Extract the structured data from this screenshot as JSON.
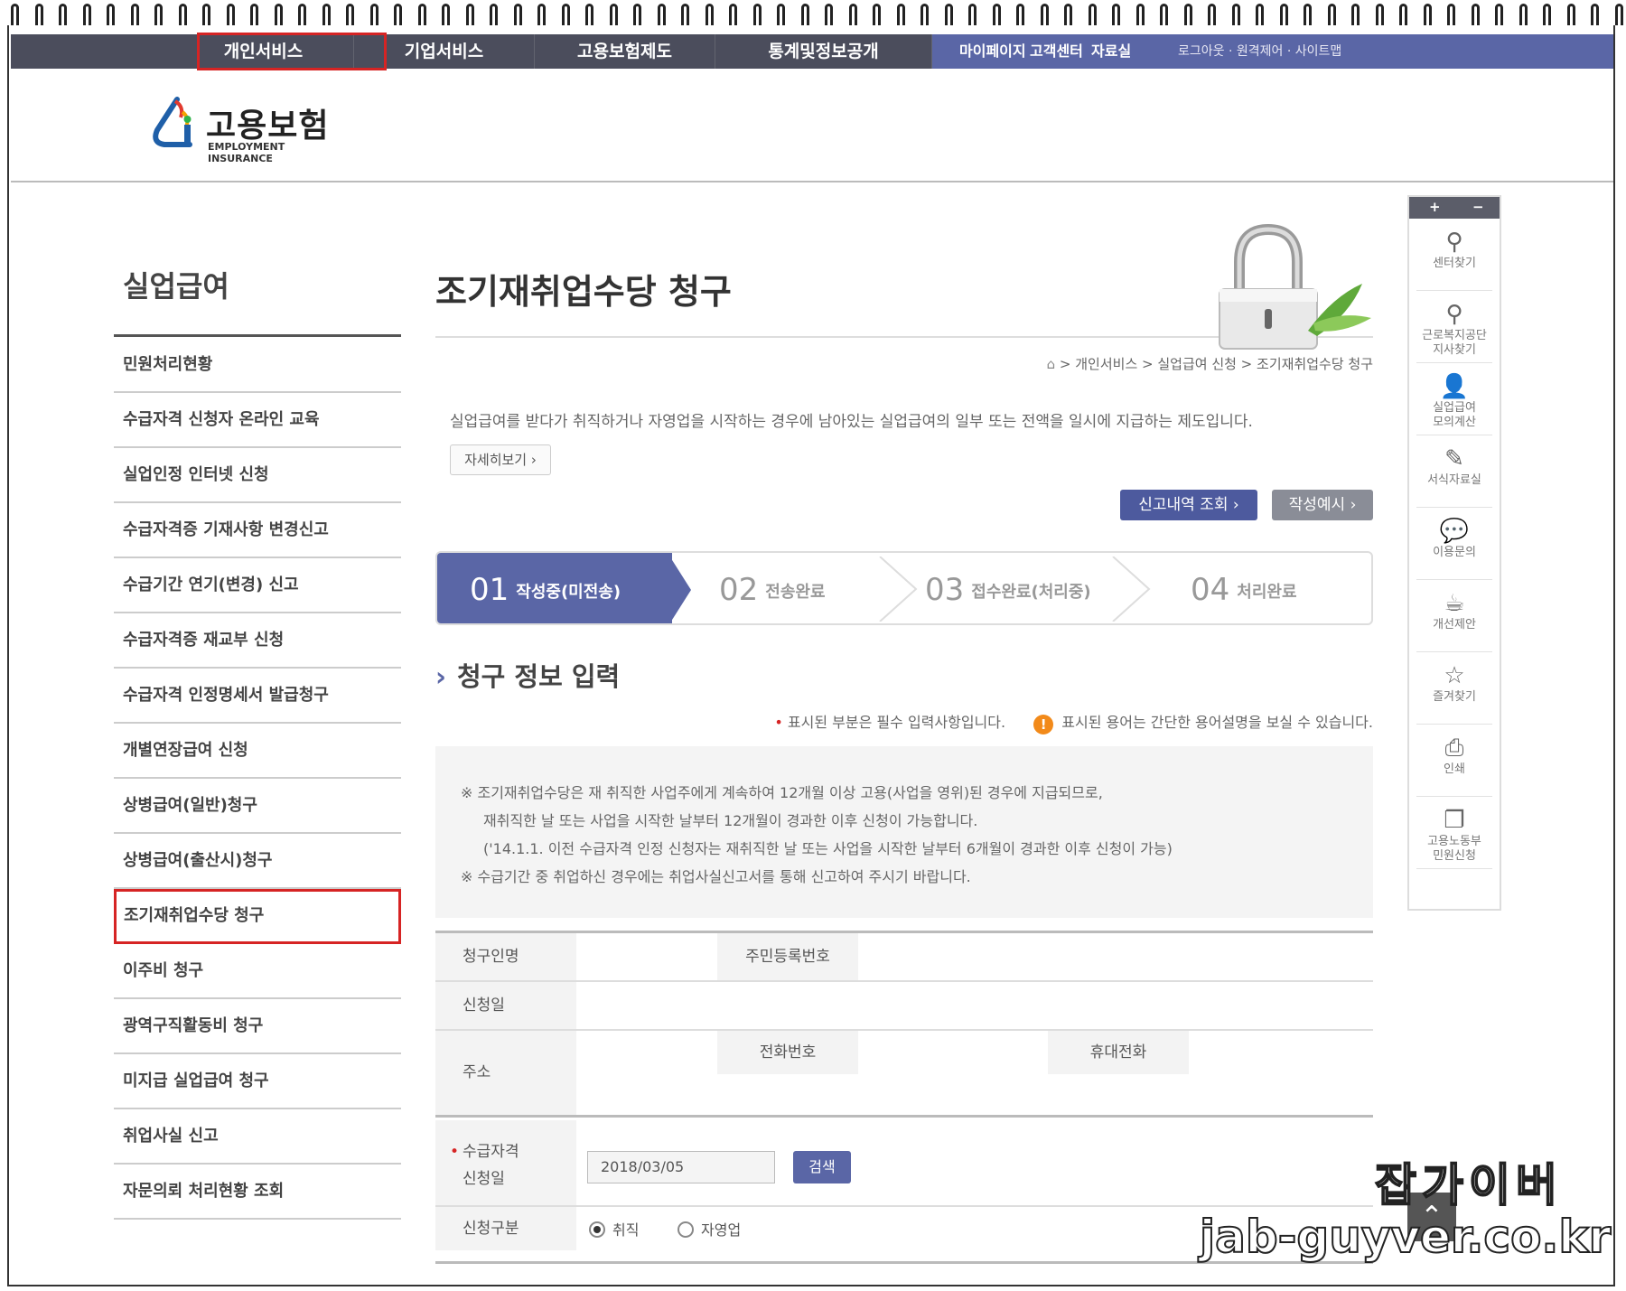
{
  "top_nav": {
    "items": [
      "개인서비스",
      "기업서비스",
      "고용보험제도",
      "통계및정보공개"
    ],
    "util_main": [
      "마이페이지",
      "고객센터",
      "자료실"
    ],
    "util_small": "로그아웃 · 원격제어 · 사이트맵"
  },
  "logo": {
    "title": "고용보험",
    "subtitle": "EMPLOYMENT INSURANCE"
  },
  "sidebar": {
    "title": "실업급여",
    "items": [
      "민원처리현황",
      "수급자격 신청자 온라인 교육",
      "실업인정 인터넷 신청",
      "수급자격증 기재사항 변경신고",
      "수급기간 연기(변경) 신고",
      "수급자격증 재교부 신청",
      "수급자격 인정명세서 발급청구",
      "개별연장급여 신청",
      "상병급여(일반)청구",
      "상병급여(출산시)청구",
      "조기재취업수당 청구",
      "이주비 청구",
      "광역구직활동비 청구",
      "미지급 실업급여 청구",
      "취업사실 신고",
      "자문의뢰 처리현황 조회"
    ],
    "active_index": 10
  },
  "main": {
    "title": "조기재취업수당 청구",
    "breadcrumb": "> 개인서비스 > 실업급여 신청 > 조기재취업수당 청구",
    "description": "실업급여를 받다가 취직하거나 자영업을 시작하는 경우에 남아있는 실업급여의 일부 또는 전액을 일시에 지급하는 제도입니다.",
    "more_button": "자세히보기 ›",
    "history_button": "신고내역 조회 ›",
    "example_button": "작성예시 ›",
    "steps": [
      {
        "num": "01",
        "label": "작성중(미전송)"
      },
      {
        "num": "02",
        "label": "전송완료"
      },
      {
        "num": "03",
        "label": "접수완료(처리중)"
      },
      {
        "num": "04",
        "label": "처리완료"
      }
    ],
    "section_title": "청구 정보 입력",
    "required_note": "표시된 부분은 필수 입력사항입니다.",
    "term_note": "표시된 용어는 간단한 용어설명을 보실 수 있습니다.",
    "notice": [
      "※ 조기재취업수당은 재 취직한 사업주에게 계속하여 12개월 이상 고용(사업을 영위)된 경우에 지급되므로,",
      "재취직한 날 또는 사업을 시작한 날부터 12개월이 경과한 이후 신청이 가능합니다.",
      "('14.1.1. 이전 수급자격 인정 신청자는 재취직한 날 또는 사업을 시작한 날부터 6개월이 경과한 이후 신청이 가능)",
      "※ 수급기간 중 취업하신 경우에는 취업사실신고서를 통해 신고하여 주시기 바랍니다."
    ],
    "form": {
      "claimant_name": "청구인명",
      "resident_no": "주민등록번호",
      "apply_date": "신청일",
      "address": "주소",
      "phone": "전화번호",
      "mobile": "휴대전화",
      "qual_date_label_1": "수급자격",
      "qual_date_label_2": "신청일",
      "qual_date_value": "2018/03/05",
      "search_button": "검색",
      "apply_type": "신청구분",
      "radio_employed": "취직",
      "radio_self": "자영업"
    }
  },
  "quick_menu": {
    "plus": "+",
    "minus": "−",
    "items": [
      {
        "icon": "map-pin-icon",
        "label": "센터찾기"
      },
      {
        "icon": "map-pin-icon",
        "label": "근로복지공단\n지사찾기"
      },
      {
        "icon": "user-icon",
        "label": "실업급여\n모의계산"
      },
      {
        "icon": "edit-icon",
        "label": "서식자료실"
      },
      {
        "icon": "chat-icon",
        "label": "이용문의"
      },
      {
        "icon": "cup-icon",
        "label": "개선제안"
      },
      {
        "icon": "star-icon",
        "label": "즐겨찾기"
      },
      {
        "icon": "print-icon",
        "label": "인쇄"
      },
      {
        "icon": "copy-icon",
        "label": "고용노동부\n민원신청"
      }
    ]
  },
  "watermark": {
    "line1": "잡가이버",
    "line2": "jab-guyver.co.kr"
  },
  "colors": {
    "accent": "#5a66a6",
    "nav": "#4b4d5c",
    "highlight": "#d62424"
  }
}
